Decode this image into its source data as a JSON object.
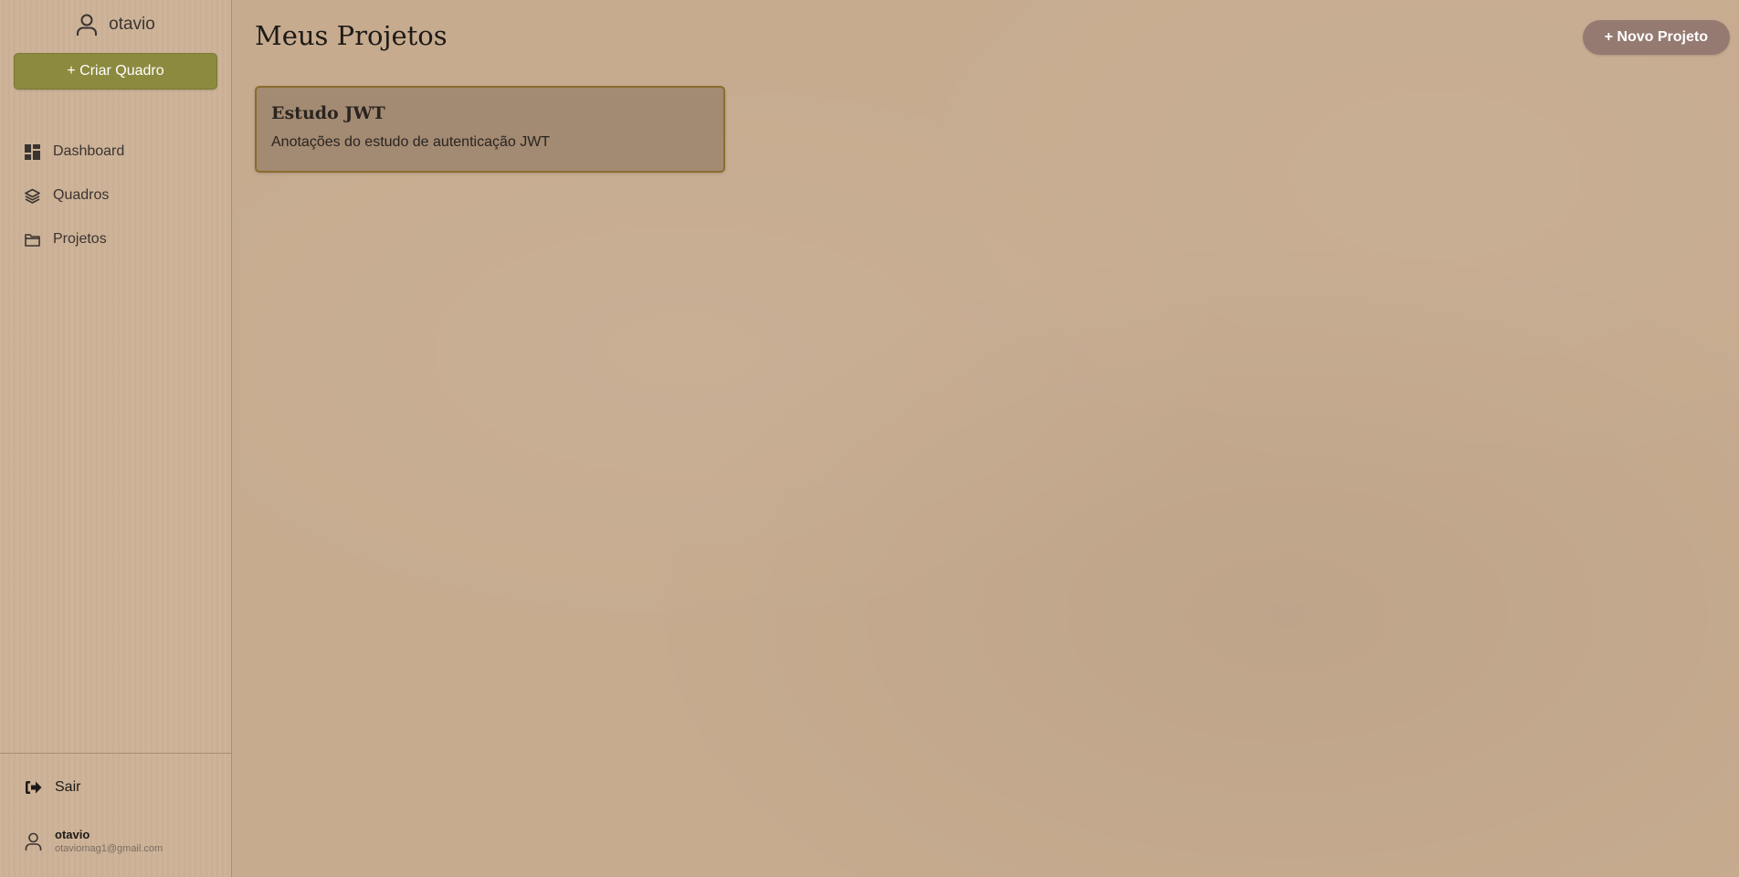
{
  "sidebar": {
    "user": {
      "name": "otavio",
      "icon": "user-icon"
    },
    "create_button": {
      "label": "+ Criar Quadro",
      "color": "#8c8a3e"
    },
    "nav": [
      {
        "label": "Dashboard",
        "icon": "dashboard-icon"
      },
      {
        "label": "Quadros",
        "icon": "layers-icon"
      },
      {
        "label": "Projetos",
        "icon": "folder-icon"
      }
    ],
    "logout": {
      "label": "Sair",
      "icon": "logout-icon"
    },
    "footer_user": {
      "name": "otavio",
      "email": "otaviomag1@gmail.com",
      "icon": "user-icon"
    }
  },
  "main": {
    "title": "Meus Projetos",
    "new_project_button": {
      "label": "+ Novo Projeto",
      "color": "#957a72"
    },
    "projects": [
      {
        "title": "Estudo JWT",
        "description": "Anotações do estudo de autenticação JWT"
      }
    ]
  },
  "colors": {
    "background": "#c6ab8f",
    "sidebar_bg": "#cdb297",
    "card_border": "#8a6d2e"
  }
}
